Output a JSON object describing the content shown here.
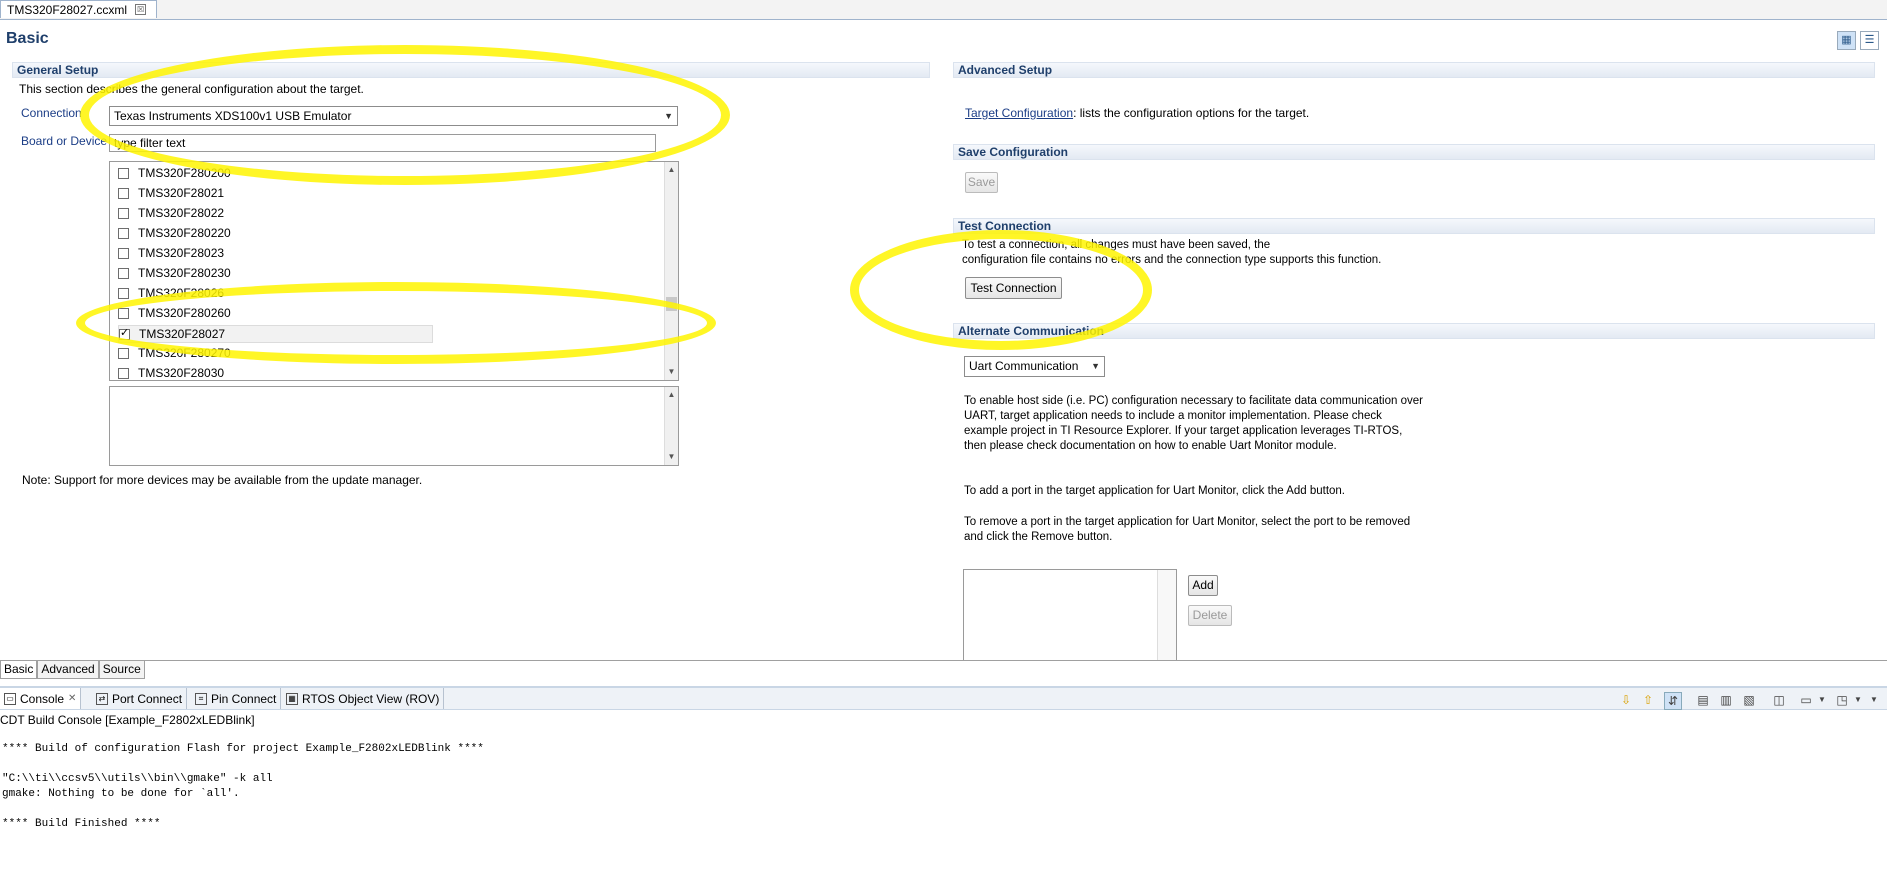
{
  "editor_tab": {
    "title": "TMS320F28027.ccxml",
    "close": "☒"
  },
  "page_title": "Basic",
  "general_setup": {
    "heading": "General Setup",
    "description": "This section describes the general configuration about the target.",
    "connection_label": "Connection",
    "connection_value": "Texas Instruments XDS100v1 USB Emulator",
    "board_label": "Board or Device",
    "filter_value": "type filter text",
    "devices": [
      {
        "name": "TMS320F280200",
        "checked": false
      },
      {
        "name": "TMS320F28021",
        "checked": false
      },
      {
        "name": "TMS320F28022",
        "checked": false
      },
      {
        "name": "TMS320F280220",
        "checked": false
      },
      {
        "name": "TMS320F28023",
        "checked": false
      },
      {
        "name": "TMS320F280230",
        "checked": false
      },
      {
        "name": "TMS320F28026",
        "checked": false
      },
      {
        "name": "TMS320F280260",
        "checked": false
      },
      {
        "name": "TMS320F28027",
        "checked": true
      },
      {
        "name": "TMS320F280270",
        "checked": false
      },
      {
        "name": "TMS320F28030",
        "checked": false
      }
    ],
    "note": "Note: Support for more devices may be available from the update manager."
  },
  "advanced_setup": {
    "heading": "Advanced Setup",
    "link_text": "Target Configuration",
    "link_suffix": ": lists the configuration options for the target."
  },
  "save_configuration": {
    "heading": "Save Configuration",
    "save_label": "Save"
  },
  "test_connection": {
    "heading": "Test Connection",
    "line1": "To test a connection, all changes must have been saved, the",
    "line2": "configuration file contains no errors and the connection type supports this function.",
    "button_label": "Test Connection"
  },
  "alternate_communication": {
    "heading": "Alternate Communication",
    "select_value": "Uart Communication",
    "para1": "To enable host side (i.e. PC) configuration necessary to facilitate data communication over UART, target application needs to include a monitor implementation. Please check example project in TI Resource Explorer. If your target application leverages TI-RTOS, then please check documentation on how to enable Uart Monitor module.",
    "para2": "To add a port in the target application for Uart Monitor, click the Add button.",
    "para3": "To remove a port in the target application for Uart Monitor, select the port to be removed and click the Remove button.",
    "add_label": "Add",
    "delete_label": "Delete"
  },
  "bottom_tabs": [
    "Basic",
    "Advanced",
    "Source"
  ],
  "console": {
    "tabs": [
      "Console",
      "Port Connect",
      "Pin Connect",
      "RTOS Object View (ROV)"
    ],
    "subtitle": "CDT Build Console [Example_F2802xLEDBlink]",
    "output": "**** Build of configuration Flash for project Example_F2802xLEDBlink ****\n\n\"C:\\\\ti\\\\ccsv5\\\\utils\\\\bin\\\\gmake\" -k all\ngmake: Nothing to be done for `all'.\n\n**** Build Finished ****"
  },
  "colors": {
    "accent": "#1f3f6b",
    "highlight": "#fff500"
  }
}
